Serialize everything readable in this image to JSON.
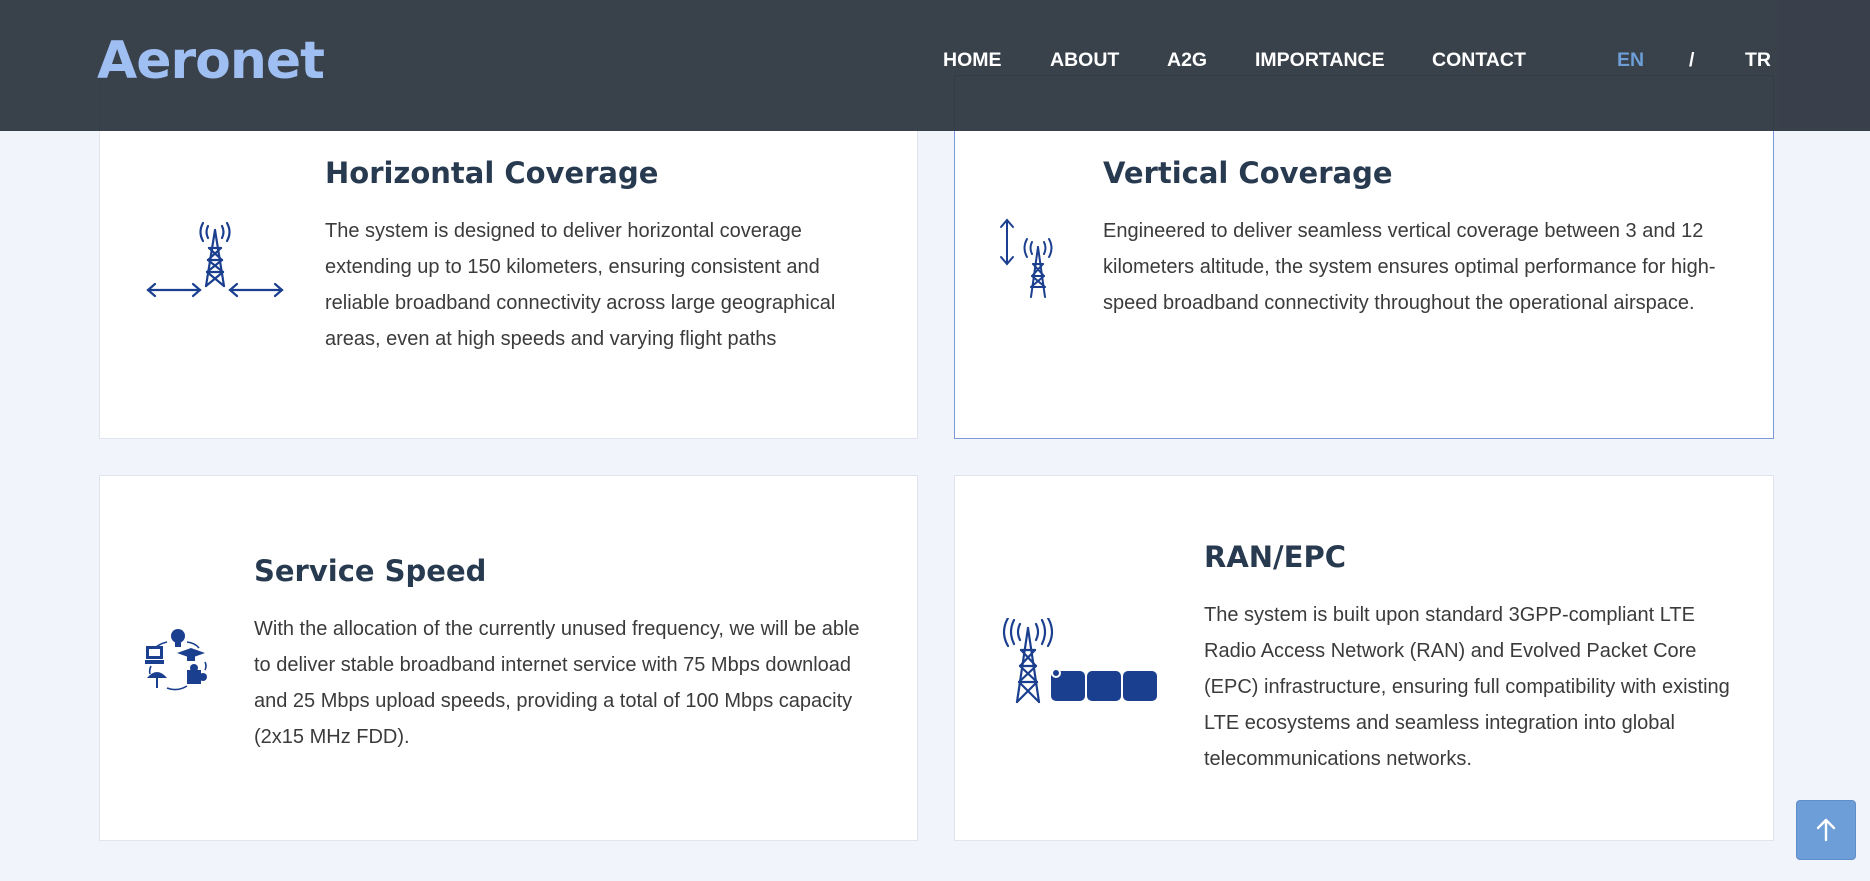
{
  "header": {
    "logo": "Aeronet",
    "nav": [
      "HOME",
      "ABOUT",
      "A2G",
      "IMPORTANCE",
      "CONTACT"
    ],
    "lang": {
      "en": "EN",
      "separator": "/",
      "tr": "TR",
      "active": "EN"
    }
  },
  "colors": {
    "header_bg": "#2d3540",
    "logo": "#9fbff2",
    "accent": "#6d9ed8",
    "icon_blue": "#1b3f8f",
    "title": "#283a4f",
    "page_bg": "#f1f4fa"
  },
  "cards": [
    {
      "title": "Horizontal Coverage",
      "text": "The system is designed to deliver horizontal coverage extending up to 150 kilometers, ensuring consistent and reliable broadband connectivity across large geographical areas, even at high speeds and varying flight paths",
      "icon": "tower-horizontal-arrows-icon"
    },
    {
      "title": "Vertical Coverage",
      "text": "Engineered to deliver seamless vertical coverage between 3 and 12 kilometers altitude, the system ensures optimal performance for high-speed broadband connectivity throughout the operational airspace.",
      "icon": "tower-vertical-arrow-icon"
    },
    {
      "title": "Service Speed",
      "text": "With the allocation of the currently unused frequency, we will be able to deliver stable broadband internet service with 75 Mbps download and 25 Mbps upload speeds, providing a total of 100 Mbps capacity (2x15 MHz FDD).",
      "icon": "services-cycle-icon"
    },
    {
      "title": "RAN/EPC",
      "text": "The system is built upon standard 3GPP-compliant LTE Radio Access Network (RAN) and Evolved Packet Core (EPC) infrastructure, ensuring full compatibility with existing LTE ecosystems and seamless integration into global telecommunications networks.",
      "icon": "tower-core-network-icon"
    }
  ],
  "scroll_top": {
    "icon": "arrow-up-icon"
  }
}
